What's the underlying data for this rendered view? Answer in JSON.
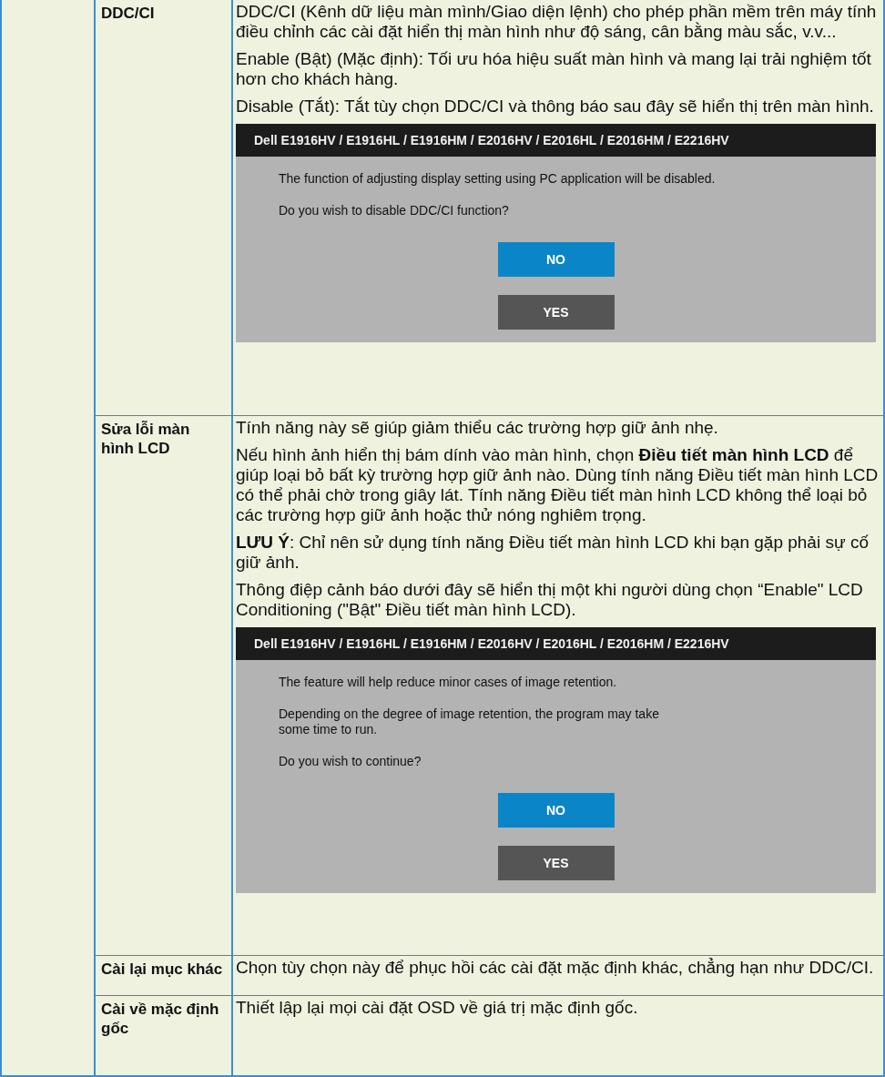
{
  "rows": [
    {
      "label": "DDC/CI",
      "content": [
        {
          "kind": "paragraph",
          "text": "DDC/CI (Kênh dữ liệu màn mình/Giao diện lệnh) cho phép phần mềm trên máy tính điều chỉnh các cài đặt hiển thị màn hình như độ sáng, cân bằng màu sắc, v.v..."
        },
        {
          "kind": "paragraph",
          "text": "Enable (Bật) (Mặc định): Tối ưu hóa hiệu suất màn hình và mang lại trải nghiệm tốt hơn cho khách hàng."
        },
        {
          "kind": "paragraph",
          "text": "Disable (Tắt): Tắt tùy chọn DDC/CI và thông báo sau đây sẽ hiển thị trên màn hình."
        },
        {
          "kind": "dialog",
          "title": "Dell E1916HV / E1916HL / E1916HM / E2016HV / E2016HL / E2016HM / E2216HV",
          "messages": [
            "The function of adjusting display setting using PC application will be disabled.",
            "Do you wish to disable DDC/CI function?"
          ],
          "buttons": [
            {
              "label": "NO",
              "kind": "primary"
            },
            {
              "label": "YES",
              "kind": "secondary"
            }
          ]
        }
      ]
    },
    {
      "label": "Sửa lỗi màn hình LCD",
      "content": [
        {
          "kind": "paragraph",
          "text": "Tính năng này sẽ giúp giảm thiểu các trường hợp giữ ảnh nhẹ."
        },
        {
          "kind": "paragraph",
          "text": "Nếu hình ảnh hiển thị bám dính vào màn hình, chọn **Điều tiết màn hình LCD** để giúp loại bỏ bất kỳ trường hợp giữ ảnh nào. Dùng tính năng Điều tiết màn hình LCD có thể phải chờ trong giây lát. Tính năng Điều tiết màn hình LCD không thể loại bỏ các trường hợp giữ ảnh hoặc thử nóng nghiêm trọng."
        },
        {
          "kind": "paragraph",
          "text": "**LƯU Ý**: Chỉ nên sử dụng tính năng Điều tiết màn hình LCD khi bạn gặp phải sự cố giữ ảnh."
        },
        {
          "kind": "paragraph",
          "text": "Thông điệp cảnh báo dưới đây sẽ hiển thị một khi người dùng chọn “Enable\" LCD Conditioning (\"Bật\" Điều tiết màn hình LCD)."
        },
        {
          "kind": "dialog",
          "title": "Dell E1916HV / E1916HL / E1916HM / E2016HV / E2016HL / E2016HM / E2216HV",
          "messages": [
            "The feature will help reduce minor cases of image retention.",
            "Depending on the degree of image retention, the program may take\nsome time to run.",
            "Do you wish to continue?"
          ],
          "buttons": [
            {
              "label": "NO",
              "kind": "primary"
            },
            {
              "label": "YES",
              "kind": "secondary"
            }
          ]
        }
      ]
    },
    {
      "label": "Cài lại mục khác",
      "content": [
        {
          "kind": "paragraph",
          "text": "Chọn tùy chọn này để phục hồi các cài đặt mặc định khác, chẳng hạn như DDC/CI."
        }
      ]
    },
    {
      "label": "Cài về mặc định gốc",
      "content": [
        {
          "kind": "paragraph",
          "text": "Thiết lập lại mọi cài đặt OSD về giá trị mặc định gốc."
        }
      ]
    }
  ]
}
